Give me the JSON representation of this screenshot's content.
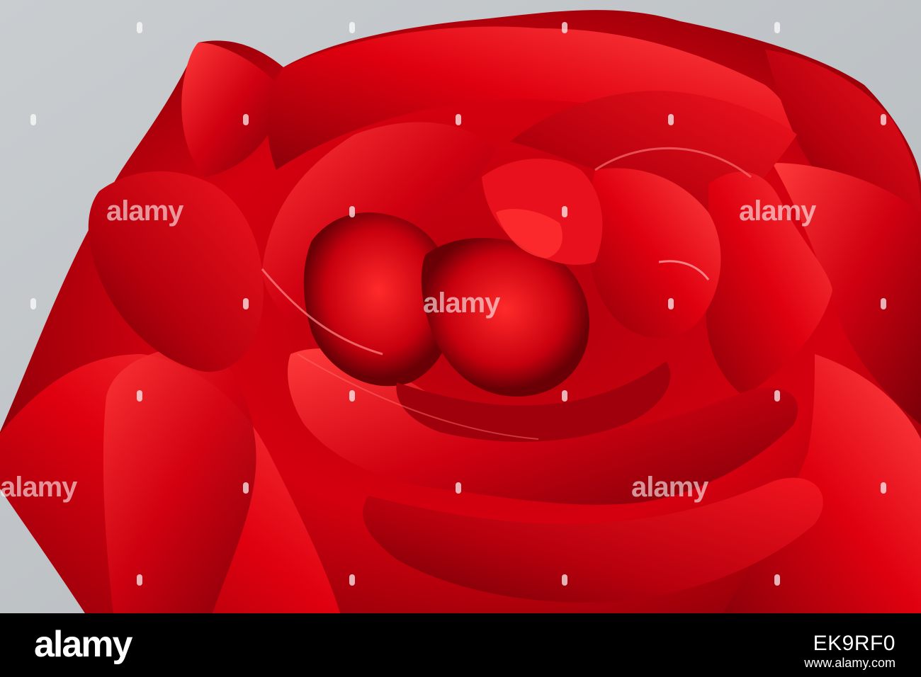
{
  "photo": {
    "subject": "red-rose",
    "colors": {
      "background": "#c3c8cb",
      "petal_deep": "#7a0008",
      "petal_mid": "#c4000e",
      "petal_bright": "#f0101e",
      "petal_highlight": "#ff4a4a"
    }
  },
  "watermark": {
    "word": "alamy"
  },
  "footer": {
    "brand": "alamy",
    "image_id": "EK9RF0",
    "site": "www.alamy.com"
  }
}
